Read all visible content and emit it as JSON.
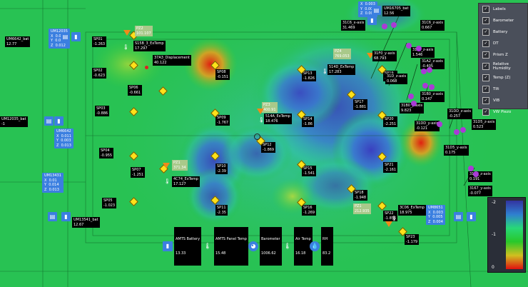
{
  "legend": {
    "items": [
      "Labels",
      "Barometer",
      "Battery",
      "DT",
      "Prism Z",
      "Relative Humidity",
      "Temp (Z)",
      "Tilt",
      "VIB",
      "VW Piezo"
    ]
  },
  "scale": {
    "ticks": [
      "-2",
      "-1",
      "0"
    ]
  },
  "sensors": [
    {
      "name": "SP01",
      "value": "-1.263"
    },
    {
      "name": "SP02",
      "value": "-0.623"
    },
    {
      "name": "SP03",
      "value": "-0.886"
    },
    {
      "name": "SP04",
      "value": "-0.955"
    },
    {
      "name": "SP05",
      "value": "-1.023"
    },
    {
      "name": "SP06",
      "value": "-0.661"
    },
    {
      "name": "SP07",
      "value": "-1.251"
    },
    {
      "name": "SP08",
      "value": "-0.151"
    },
    {
      "name": "SP09",
      "value": "-1.767"
    },
    {
      "name": "SP10",
      "value": "-2.39"
    },
    {
      "name": "SP11",
      "value": "-2.35"
    },
    {
      "name": "SP12",
      "value": "-1.869"
    },
    {
      "name": "SP13",
      "value": "-1.826"
    },
    {
      "name": "SP14",
      "value": "-1.86"
    },
    {
      "name": "SP15",
      "value": "-1.541"
    },
    {
      "name": "SP16",
      "value": "-1.269"
    },
    {
      "name": "SP17",
      "value": "-1.881"
    },
    {
      "name": "SP18",
      "value": "-1.948"
    },
    {
      "name": "SP19",
      "value": "-1.596"
    },
    {
      "name": "SP20",
      "value": "-2.251"
    },
    {
      "name": "SP21",
      "value": "-2.161"
    },
    {
      "name": "SP22",
      "value": "-1.856"
    },
    {
      "name": "SP23",
      "value": "-1.179"
    }
  ],
  "temps": [
    {
      "name": "S15B_3_ExTemp",
      "value": "17.297"
    },
    {
      "name": "514D_ExTemp",
      "value": "17.283"
    },
    {
      "name": "514A_ExTemp",
      "value": "18.476"
    },
    {
      "name": "4C74_ExTemp",
      "value": "17.127"
    },
    {
      "name": "3C06_ExTemp",
      "value": "18.975"
    }
  ],
  "pz": [
    {
      "name": "PZ2",
      "value": "101.107"
    },
    {
      "name": "PZ4",
      "value": "769.053"
    },
    {
      "name": "PZ3",
      "value": "400.91"
    },
    {
      "name": "PZ1",
      "value": "371.34"
    },
    {
      "name": "PZ1",
      "value": "212.935"
    }
  ],
  "displacement": {
    "name": "37A3_Displacement",
    "value": "40.122"
  },
  "axes": [
    {
      "name": "31C6_x-axis",
      "value": "31.469"
    },
    {
      "name": "31C6_z-axis",
      "value": "0.667"
    },
    {
      "name": "31F0_z-axis",
      "value": "1.546"
    },
    {
      "name": "31F0_y-axis",
      "value": "68.793"
    },
    {
      "name": "31A2_z-axis",
      "value": "-0.405"
    },
    {
      "name": "31D_z-axis",
      "value": "0.068"
    },
    {
      "name": "31B0_y-axis",
      "value": "9.823"
    },
    {
      "name": "31B0_z-axis",
      "value": "0.147"
    },
    {
      "name": "31DD_z-axis",
      "value": "-0.257"
    },
    {
      "name": "31DD_y-axis",
      "value": "-0.121"
    },
    {
      "name": "31D5_z-axis",
      "value": "0.523"
    },
    {
      "name": "31D5_y-axis",
      "value": "0.175"
    },
    {
      "name": "3167_z-axis",
      "value": "0.191"
    },
    {
      "name": "3167_y-axis",
      "value": "-0.077"
    }
  ],
  "batteries": [
    {
      "name": "UM6642_bat",
      "value": "12.77"
    },
    {
      "name": "UM12035_bat",
      "value": "-1"
    },
    {
      "name": "UM16705_bat",
      "value": "12.56"
    },
    {
      "name": "UM13541_bat",
      "value": "12.67"
    }
  ],
  "units": [
    {
      "name": "UM12035",
      "x": "0.008",
      "y": "0.003",
      "z": "0.012"
    },
    {
      "name": "UM6642",
      "x": "0.011",
      "y": "0.003",
      "z": "0.013"
    },
    {
      "name": "UM13431",
      "x": "0.01",
      "y": "0.014",
      "z": "0.013"
    },
    {
      "name": "UM8651",
      "x": "0.003",
      "y": "0.005",
      "z": "0.004"
    },
    {
      "name": "",
      "x": "0.003",
      "y": "0.005",
      "z": "0.005"
    }
  ],
  "status": {
    "battery_label": "AMTS Battery",
    "battery_value": "13.33",
    "panel_label": "AMTS Panel Temp",
    "panel_value": "15.48",
    "baro_label": "Barometer",
    "baro_value": "1006.62",
    "air_label": "Air Temp",
    "air_value": "16.18",
    "rh_label": "RH",
    "rh_value": "83.2"
  },
  "colors": {
    "accent": "#3b7fe0",
    "sensor": "#ffe01a",
    "tilt": "#a93bd6"
  }
}
